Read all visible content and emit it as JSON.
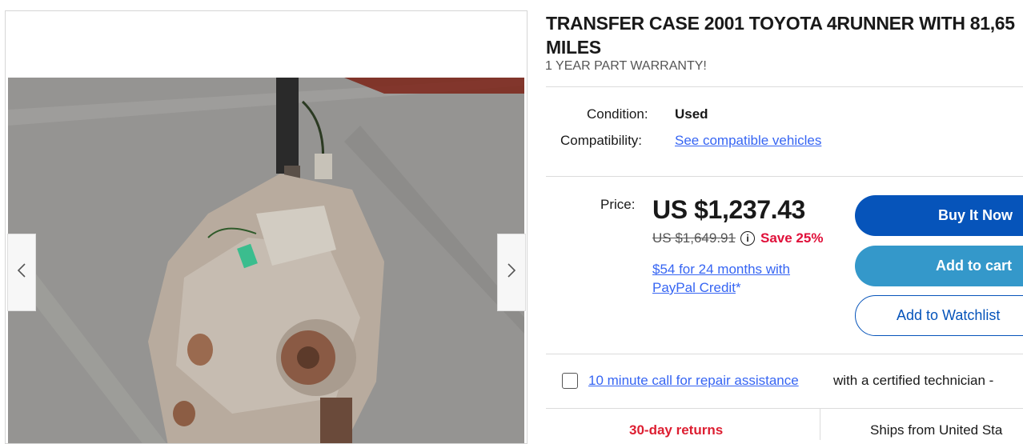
{
  "listing": {
    "title_line1": "TRANSFER CASE 2001 TOYOTA 4RUNNER WITH 81,65",
    "title_line2": "MILES",
    "subtitle": "1 YEAR PART WARRANTY!"
  },
  "details": {
    "condition_label": "Condition:",
    "condition_value": "Used",
    "compat_label": "Compatibility:",
    "compat_link": "See compatible vehicles"
  },
  "pricing": {
    "price_label": "Price:",
    "price": "US $1,237.43",
    "was_price": "US $1,649.91",
    "save": "Save 25%",
    "paypal_link": "$54 for 24 months with PayPal Credit",
    "paypal_suffix": "*"
  },
  "actions": {
    "buy_now": "Buy It Now",
    "add_to_cart": "Add to cart",
    "add_to_watchlist": "Add to Watchlist"
  },
  "addon": {
    "link": "10 minute call for repair assistance",
    "rest": "with a certified technician -"
  },
  "bottom": {
    "returns": "30-day returns",
    "ships": "Ships from United Sta"
  },
  "colors": {
    "primary_button": "#0654ba",
    "secondary_button": "#3498ca",
    "link": "#3665f3",
    "save": "#e0103a"
  },
  "icons": [
    "chevron-left-icon",
    "chevron-right-icon",
    "info-icon"
  ]
}
